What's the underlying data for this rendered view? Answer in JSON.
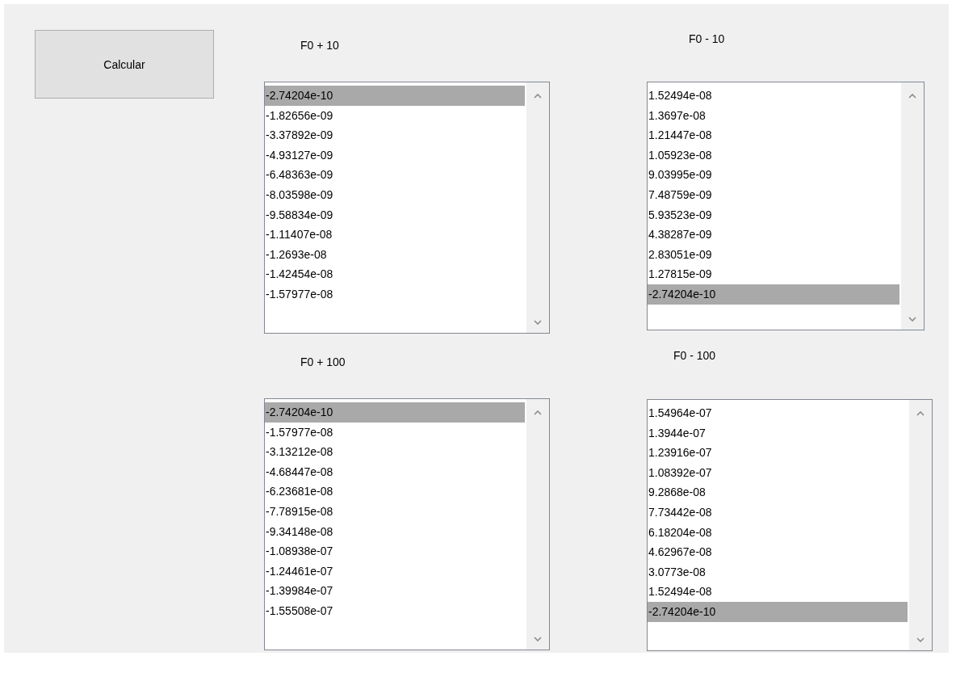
{
  "button": {
    "label": "Calcular"
  },
  "lists": [
    {
      "label": "F0 + 10",
      "items": [
        {
          "text": "-2.74204e-10",
          "selected": true
        },
        {
          "text": "-1.82656e-09",
          "selected": false
        },
        {
          "text": "-3.37892e-09",
          "selected": false
        },
        {
          "text": "-4.93127e-09",
          "selected": false
        },
        {
          "text": "-6.48363e-09",
          "selected": false
        },
        {
          "text": "-8.03598e-09",
          "selected": false
        },
        {
          "text": "-9.58834e-09",
          "selected": false
        },
        {
          "text": "-1.11407e-08",
          "selected": false
        },
        {
          "text": "-1.2693e-08",
          "selected": false
        },
        {
          "text": "-1.42454e-08",
          "selected": false
        },
        {
          "text": "-1.57977e-08",
          "selected": false
        }
      ]
    },
    {
      "label": "F0 - 10",
      "items": [
        {
          "text": "1.52494e-08",
          "selected": false
        },
        {
          "text": "1.3697e-08",
          "selected": false
        },
        {
          "text": "1.21447e-08",
          "selected": false
        },
        {
          "text": "1.05923e-08",
          "selected": false
        },
        {
          "text": "9.03995e-09",
          "selected": false
        },
        {
          "text": "7.48759e-09",
          "selected": false
        },
        {
          "text": "5.93523e-09",
          "selected": false
        },
        {
          "text": "4.38287e-09",
          "selected": false
        },
        {
          "text": "2.83051e-09",
          "selected": false
        },
        {
          "text": "1.27815e-09",
          "selected": false
        },
        {
          "text": "-2.74204e-10",
          "selected": true
        }
      ]
    },
    {
      "label": "F0 + 100",
      "items": [
        {
          "text": "-2.74204e-10",
          "selected": true
        },
        {
          "text": "-1.57977e-08",
          "selected": false
        },
        {
          "text": "-3.13212e-08",
          "selected": false
        },
        {
          "text": "-4.68447e-08",
          "selected": false
        },
        {
          "text": "-6.23681e-08",
          "selected": false
        },
        {
          "text": "-7.78915e-08",
          "selected": false
        },
        {
          "text": "-9.34148e-08",
          "selected": false
        },
        {
          "text": "-1.08938e-07",
          "selected": false
        },
        {
          "text": "-1.24461e-07",
          "selected": false
        },
        {
          "text": "-1.39984e-07",
          "selected": false
        },
        {
          "text": "-1.55508e-07",
          "selected": false
        }
      ]
    },
    {
      "label": "F0 - 100",
      "items": [
        {
          "text": "1.54964e-07",
          "selected": false
        },
        {
          "text": "1.3944e-07",
          "selected": false
        },
        {
          "text": "1.23916e-07",
          "selected": false
        },
        {
          "text": "1.08392e-07",
          "selected": false
        },
        {
          "text": "9.2868e-08",
          "selected": false
        },
        {
          "text": "7.73442e-08",
          "selected": false
        },
        {
          "text": "6.18204e-08",
          "selected": false
        },
        {
          "text": "4.62967e-08",
          "selected": false
        },
        {
          "text": "3.0773e-08",
          "selected": false
        },
        {
          "text": "1.52494e-08",
          "selected": false
        },
        {
          "text": "-2.74204e-10",
          "selected": true
        }
      ]
    }
  ]
}
